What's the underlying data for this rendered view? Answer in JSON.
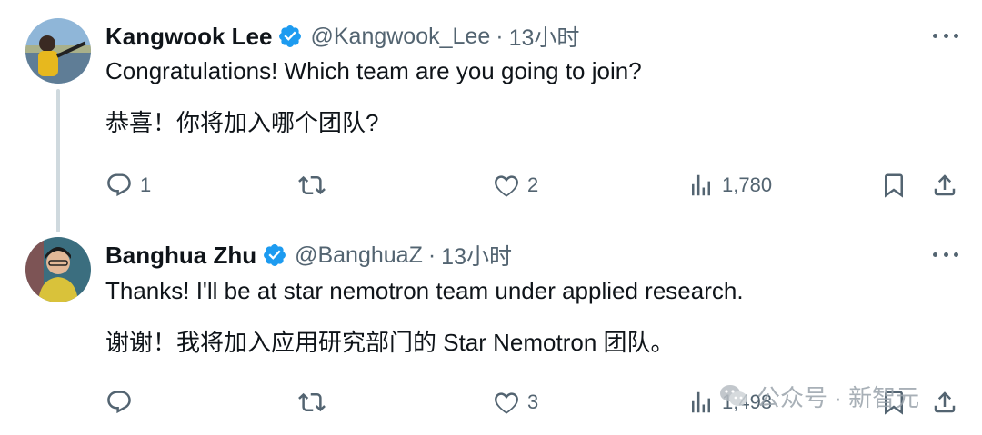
{
  "tweets": [
    {
      "name": "Kangwook Lee",
      "handle": "@Kangwook_Lee",
      "separator": "·",
      "time": "13小时",
      "text_en": "Congratulations!  Which team are you going to join?",
      "text_zh": "恭喜！你将加入哪个团队?",
      "replies": "1",
      "retweets": "",
      "likes": "2",
      "views": "1,780"
    },
    {
      "name": "Banghua Zhu",
      "handle": "@BanghuaZ",
      "separator": "·",
      "time": "13小时",
      "text_en": "Thanks! I'll be at star nemotron team under applied research.",
      "text_zh": "谢谢！我将加入应用研究部门的 Star Nemotron 团队。",
      "replies": "",
      "retweets": "",
      "likes": "3",
      "views": "1,498"
    }
  ],
  "watermark": {
    "text": "公众号 · 新智元",
    "icon": "wechat-icon"
  },
  "colors": {
    "text": "#0f1419",
    "muted": "#536471",
    "verified": "#1d9bf0",
    "thread_line": "#cfd9de"
  },
  "icons": [
    "verified-badge-icon",
    "more-icon",
    "reply-icon",
    "retweet-icon",
    "like-icon",
    "views-icon",
    "bookmark-icon",
    "share-icon"
  ]
}
